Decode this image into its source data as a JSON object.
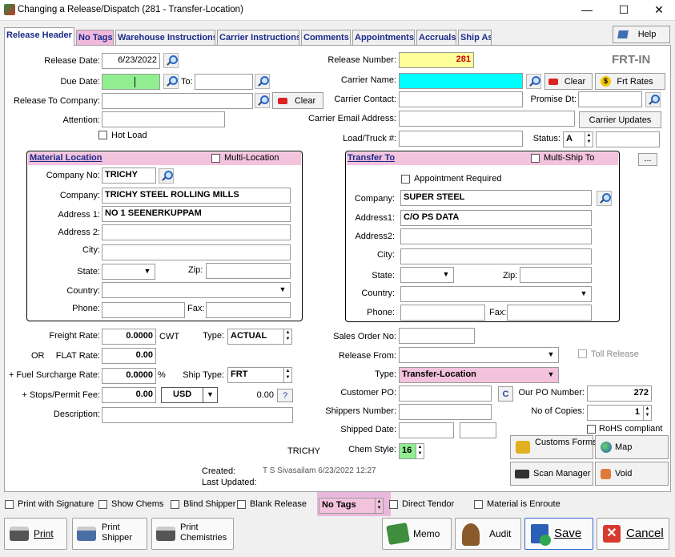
{
  "window": {
    "title": "Changing a Release/Dispatch  (281 - Transfer-Location)",
    "min": "—",
    "max": "☐",
    "close": "✕"
  },
  "tabs": [
    {
      "label": "Release Header"
    },
    {
      "label": "No Tags"
    },
    {
      "label": "Warehouse Instructions"
    },
    {
      "label": "Carrier Instructions"
    },
    {
      "label": "Comments"
    },
    {
      "label": "Appointments"
    },
    {
      "label": "Accruals"
    },
    {
      "label": "Ship As"
    }
  ],
  "help_label": "Help",
  "badge": "FRT-IN",
  "left": {
    "release_date_label": "Release Date:",
    "release_date": "6/23/2022",
    "due_date_label": "Due Date:",
    "to_label": "To:",
    "release_to_label": "Release To Company:",
    "attention_label": "Attention:",
    "clear_label": "Clear",
    "hot_load_label": "Hot Load"
  },
  "right": {
    "release_number_label": "Release Number:",
    "release_number": "281",
    "carrier_name_label": "Carrier Name:",
    "clear_label": "Clear",
    "frt_rates_label": "Frt Rates",
    "carrier_contact_label": "Carrier Contact:",
    "promise_label": "Promise Dt:",
    "carrier_email_label": "Carrier Email Address:",
    "carrier_updates_label": "Carrier Updates",
    "load_truck_label": "Load/Truck #:",
    "status_label": "Status:",
    "status_value": "A"
  },
  "material": {
    "header": "Material Location",
    "multi_label": "Multi-Location",
    "company_no_label": "Company No:",
    "company_no": "TRICHY",
    "company_label": "Company:",
    "company": "TRICHY STEEL ROLLING MILLS",
    "address1_label": "Address 1:",
    "address1": "NO 1 SEENERKUPPAM",
    "address2_label": "Address 2:",
    "city_label": "City:",
    "state_label": "State:",
    "zip_label": "Zip:",
    "country_label": "Country:",
    "phone_label": "Phone:",
    "fax_label": "Fax:"
  },
  "transfer": {
    "header": "Transfer To",
    "multi_label": "Multi-Ship To",
    "more": "...",
    "appt_label": "Appointment Required",
    "company_label": "Company:",
    "company": "SUPER STEEL",
    "address1_label": "Address1:",
    "address1": "C/O PS DATA",
    "address2_label": "Address2:",
    "city_label": "City:",
    "state_label": "State:",
    "zip_label": "Zip:",
    "country_label": "Country:",
    "phone_label": "Phone:",
    "fax_label": "Fax:"
  },
  "rates": {
    "freight_label": "Freight Rate:",
    "freight": "0.0000",
    "cwt": "CWT",
    "type_label": "Type:",
    "type": "ACTUAL",
    "or_label": "OR",
    "flat_label": "FLAT Rate:",
    "flat": "0.00",
    "fuel_label": "+ Fuel Surcharge Rate:",
    "fuel": "0.0000",
    "pct": "%",
    "ship_type_label": "Ship Type:",
    "ship_type": "FRT",
    "stops_label": "+ Stops/Permit Fee:",
    "stops": "0.00",
    "currency": "USD",
    "conv": "0.00",
    "q": "?",
    "description_label": "Description:"
  },
  "orders": {
    "sales_order_label": "Sales Order No:",
    "release_from_label": "Release From:",
    "toll_label": "Toll Release",
    "type_label": "Type:",
    "type": "Transfer-Location",
    "customer_po_label": "Customer PO:",
    "c": "C",
    "our_po_label": "Our PO Number:",
    "our_po": "272",
    "shippers_label": "Shippers Number:",
    "copies_label": "No of Copies:",
    "copies": "1",
    "shipped_label": "Shipped Date:",
    "rohs_label": "RoHS compliant",
    "chem_label": "Chem Style:",
    "chem": "16",
    "trichy": "TRICHY"
  },
  "meta": {
    "created_label": "Created:",
    "created": "T S Sivasailam 6/23/2022 12:27",
    "updated_label": "Last Updated:"
  },
  "actions": {
    "customs": "Customs Forms",
    "map": "Map",
    "scan": "Scan Manager",
    "void": "Void"
  },
  "footer": {
    "print_sig": "Print with Signature",
    "show_chems": "Show Chems",
    "blind": "Blind Shipper",
    "blank": "Blank Release",
    "tags": "No Tags",
    "direct": "Direct Tendor",
    "enroute": "Material is Enroute"
  },
  "bottom": {
    "print": "Print",
    "print_shipper": "Print Shipper",
    "print_chem": "Print Chemistries",
    "memo": "Memo",
    "audit": "Audit",
    "save": "Save",
    "cancel": "Cancel"
  },
  "colors": {
    "yellow": "#ffff99",
    "green": "#90ee90",
    "cyan": "#00ffff",
    "pink": "#f3c2dc"
  }
}
